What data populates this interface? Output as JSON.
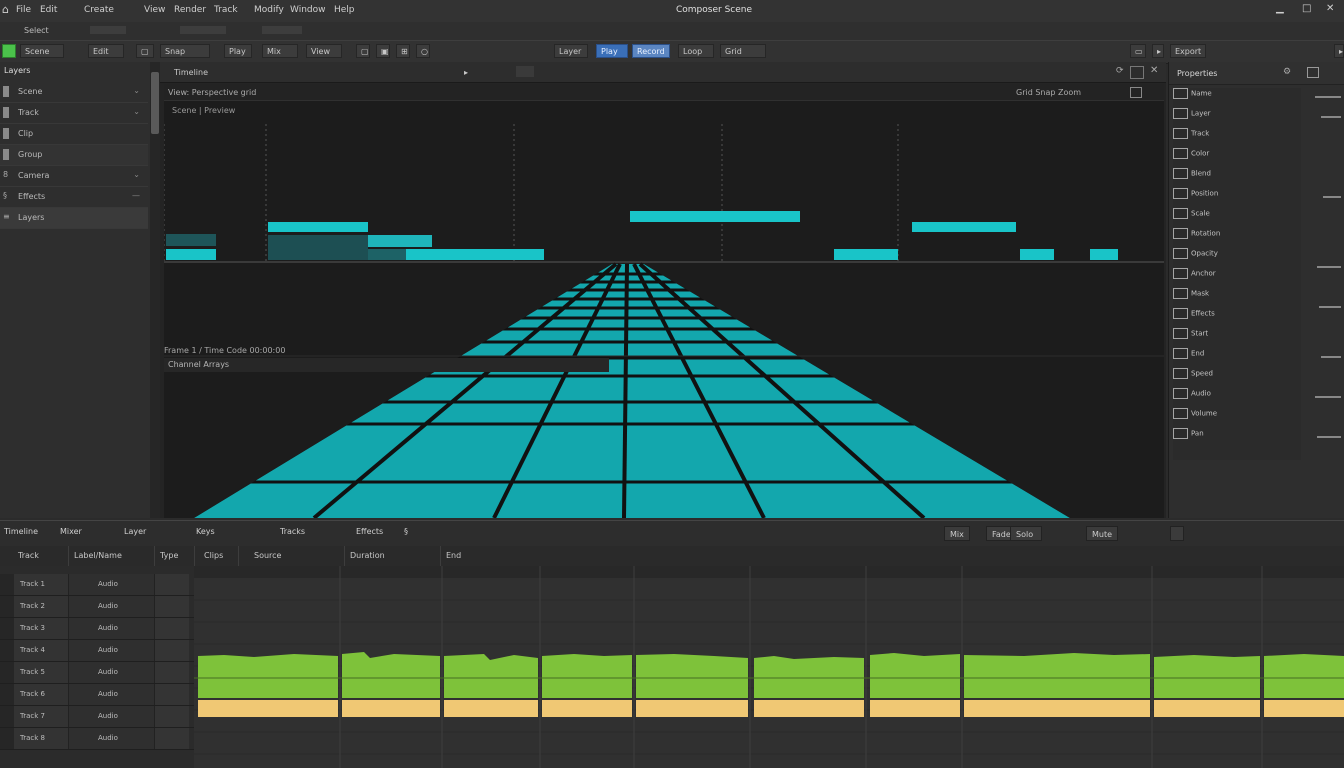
{
  "window": {
    "title": "Composer Scene"
  },
  "menubar": {
    "items": [
      "File",
      "Edit",
      "Create",
      "View",
      "Render",
      "Track",
      "Modify",
      "Window",
      "Help"
    ]
  },
  "toolbar": {
    "mode_label": "Select",
    "buttons": [
      "Scene",
      "Edit",
      "Snap",
      "Play",
      "Mix",
      "View",
      "Layer",
      "Grid"
    ],
    "blue_buttons": [
      "Play",
      "Record",
      "Loop"
    ],
    "right_button": "Export"
  },
  "left_panel": {
    "title": "Layers",
    "items": [
      {
        "label": "Scene"
      },
      {
        "label": "Track"
      },
      {
        "label": "Clip"
      },
      {
        "label": "Group"
      },
      {
        "label": "Camera"
      },
      {
        "label": "Effects"
      },
      {
        "label": "Layers"
      }
    ]
  },
  "viewport": {
    "tab_label": "Timeline",
    "header": "View: Perspective grid",
    "subheader": "Scene | Preview",
    "right_info": "Grid  Snap  Zoom",
    "status": "Frame 1 / Time Code 00:00:00",
    "section_label": "Channel Arrays"
  },
  "right_panel": {
    "title": "Properties",
    "rows": [
      {
        "label": "Name"
      },
      {
        "label": "Layer"
      },
      {
        "label": "Track"
      },
      {
        "label": "Color"
      },
      {
        "label": "Blend"
      },
      {
        "label": "Position"
      },
      {
        "label": "Scale"
      },
      {
        "label": "Rotation"
      },
      {
        "label": "Opacity"
      },
      {
        "label": "Anchor"
      },
      {
        "label": "Mask"
      },
      {
        "label": "Effects"
      },
      {
        "label": "Start"
      },
      {
        "label": "End"
      },
      {
        "label": "Speed"
      },
      {
        "label": "Audio"
      },
      {
        "label": "Volume"
      },
      {
        "label": "Pan"
      }
    ]
  },
  "bottom_panel": {
    "tabs": [
      "Timeline",
      "Mixer",
      "Layer",
      "Keys",
      "Tracks",
      "Effects"
    ],
    "buttons": [
      "Mix",
      "Fade",
      "Solo",
      "Mute"
    ],
    "columns": [
      "Track",
      "Label/Name",
      "Type",
      "Clips",
      "Source",
      "Duration",
      "End"
    ],
    "tracks": [
      {
        "name": "Track 1",
        "type": "Audio"
      },
      {
        "name": "Track 2",
        "type": "Audio"
      },
      {
        "name": "Track 3",
        "type": "Audio"
      },
      {
        "name": "Track 4",
        "type": "Audio"
      },
      {
        "name": "Track 5",
        "type": "Audio"
      },
      {
        "name": "Track 6",
        "type": "Audio"
      },
      {
        "name": "Track 7",
        "type": "Audio"
      },
      {
        "name": "Track 8",
        "type": "Audio"
      }
    ]
  },
  "colors": {
    "accent_cyan": "#19c4c8",
    "waveform_green": "#7ec23a",
    "clip_yellow": "#f0c874",
    "button_blue": "#3a6fb8"
  }
}
